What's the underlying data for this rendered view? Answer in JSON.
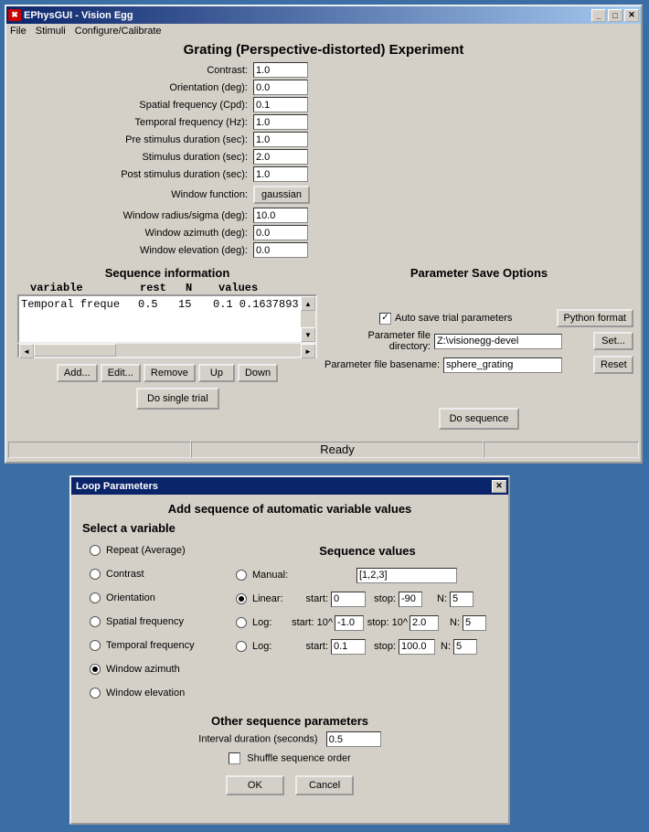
{
  "mainWindow": {
    "title": "EPhysGUI - Vision Egg",
    "menu": [
      "File",
      "Stimuli",
      "Configure/Calibrate"
    ],
    "heading": "Grating (Perspective-distorted) Experiment",
    "params": [
      {
        "label": "Contrast:",
        "value": "1.0"
      },
      {
        "label": "Orientation (deg):",
        "value": "0.0"
      },
      {
        "label": "Spatial frequency (Cpd):",
        "value": "0.1"
      },
      {
        "label": "Temporal frequency (Hz):",
        "value": "1.0"
      },
      {
        "label": "Pre stimulus duration (sec):",
        "value": "1.0"
      },
      {
        "label": "Stimulus duration (sec):",
        "value": "2.0"
      },
      {
        "label": "Post stimulus duration (sec):",
        "value": "1.0"
      }
    ],
    "windowFuncLabel": "Window function:",
    "windowFuncBtn": "gaussian",
    "windowParams": [
      {
        "label": "Window radius/sigma (deg):",
        "value": "10.0"
      },
      {
        "label": "Window azimuth (deg):",
        "value": "0.0"
      },
      {
        "label": "Window elevation (deg):",
        "value": "0.0"
      }
    ],
    "seqInfoTitle": "Sequence information",
    "seqHeaders": {
      "variable": "variable",
      "rest": "rest",
      "N": "N",
      "values": "values"
    },
    "seqRow": {
      "variable": "Temporal freque",
      "rest": "0.5",
      "N": "15",
      "values": "0.1 0.1637893"
    },
    "seqButtons": [
      "Add...",
      "Edit...",
      "Remove",
      "Up",
      "Down"
    ],
    "doSingle": "Do single trial",
    "paramSaveTitle": "Parameter Save Options",
    "autoSave": "Auto save trial parameters",
    "pythonFmt": "Python format",
    "dirLabel": "Parameter file directory:",
    "dirValue": "Z:\\visionegg-devel",
    "setBtn": "Set...",
    "baseLabel": "Parameter file basename:",
    "baseValue": "sphere_grating",
    "resetBtn": "Reset",
    "doSeq": "Do sequence",
    "status": "Ready"
  },
  "loopWindow": {
    "title": "Loop Parameters",
    "heading": "Add sequence of automatic variable values",
    "selectVar": "Select a variable",
    "vars": [
      {
        "label": "Repeat (Average)",
        "sel": false
      },
      {
        "label": "Contrast",
        "sel": false
      },
      {
        "label": "Orientation",
        "sel": false
      },
      {
        "label": "Spatial frequency",
        "sel": false
      },
      {
        "label": "Temporal frequency",
        "sel": false
      },
      {
        "label": "Window azimuth",
        "sel": true
      },
      {
        "label": "Window elevation",
        "sel": false
      }
    ],
    "seqValTitle": "Sequence values",
    "manual": {
      "label": "Manual:",
      "value": "[1,2,3]"
    },
    "linear": {
      "label": "Linear:",
      "start": "0",
      "stop": "-90",
      "N": "5",
      "startLbl": "start:",
      "stopLbl": "stop:",
      "NLbl": "N:"
    },
    "logExp": {
      "label": "Log:",
      "startPre": "start: 10^",
      "start": "-1.0",
      "stopPre": "stop: 10^",
      "stop": "2.0",
      "NLbl": "N:",
      "N": "5"
    },
    "logPlain": {
      "label": "Log:",
      "startLbl": "start:",
      "start": "0.1",
      "stopLbl": "stop:",
      "stop": "100.0",
      "NLbl": "N:",
      "N": "5"
    },
    "otherTitle": "Other sequence parameters",
    "intervalLbl": "Interval duration (seconds)",
    "intervalVal": "0.5",
    "shuffle": "Shuffle sequence order",
    "ok": "OK",
    "cancel": "Cancel"
  }
}
